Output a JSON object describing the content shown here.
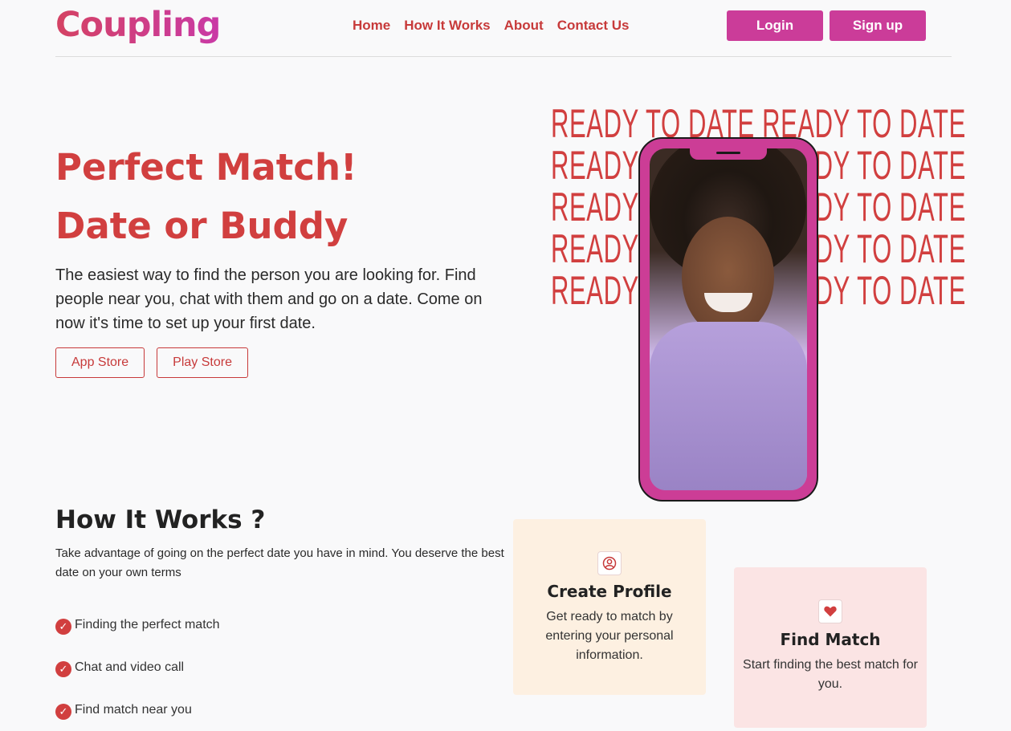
{
  "header": {
    "logo": "Coupling",
    "nav": [
      "Home",
      "How It Works",
      "About",
      "Contact Us"
    ],
    "login_label": "Login",
    "signup_label": "Sign up"
  },
  "hero": {
    "title_line1": "Perfect Match!",
    "title_line2": "Date or Buddy",
    "description": "The easiest way to find the person you are looking for. Find people near you, chat with them and go on a date. Come on now it's time to set up your first date.",
    "app_store_label": "App Store",
    "play_store_label": "Play Store",
    "ready_text": [
      "READY TO DATE READY TO DATE",
      "READY TO DATE READY TO DATE",
      "READY TO DATE READY TO DATE",
      "READY TO DATE READY TO DATE",
      "READY TO DATE READY TO DATE"
    ]
  },
  "how_it_works": {
    "title": "How It Works ?",
    "description": "Take advantage of going on the perfect date you have in mind. You deserve the best date on your own terms",
    "features": [
      "Finding the perfect match",
      "Chat and video call",
      "Find match near you"
    ]
  },
  "cards": [
    {
      "title": "Create Profile",
      "text": "Get ready to match by entering your personal information.",
      "icon": "user-circle-icon"
    },
    {
      "title": "Find Match",
      "text": "Start finding the best match for you.",
      "icon": "heart-icon"
    }
  ],
  "colors": {
    "brand_red": "#d13f3f",
    "brand_pink": "#cb3c99",
    "card_cream": "#fdf0e1",
    "card_pink": "#fbe4e4"
  }
}
